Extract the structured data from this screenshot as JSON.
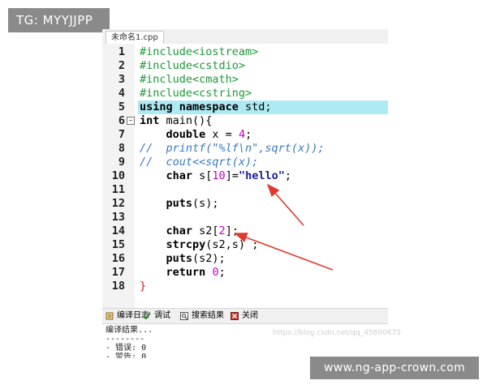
{
  "watermarks": {
    "top_left": "TG: MYYJJPP",
    "bottom_right": "www.ng-app-crown.com"
  },
  "tabbar": {
    "file_tab": "未命名1.cpp"
  },
  "code": {
    "lines": [
      {
        "num": "1",
        "html": "<span class=\"pre\">#include&lt;iostream&gt;</span>"
      },
      {
        "num": "2",
        "html": "<span class=\"pre\">#include&lt;cstdio&gt;</span>"
      },
      {
        "num": "3",
        "html": "<span class=\"pre\">#include&lt;cmath&gt;</span>"
      },
      {
        "num": "4",
        "html": "<span class=\"pre\">#include&lt;cstring&gt;</span>"
      },
      {
        "num": "5",
        "html": "<span class=\"kw\">using namespace</span> std;",
        "highlight": true
      },
      {
        "num": "6",
        "html": "<span class=\"kw\">int</span> main(){",
        "fold": true
      },
      {
        "num": "7",
        "html": "    <span class=\"kw\">double</span> x = <span class=\"num\">4</span>;"
      },
      {
        "num": "8",
        "html": "<span class=\"cmt\">//  printf(\"%lf\\n\",sqrt(x));</span>"
      },
      {
        "num": "9",
        "html": "<span class=\"cmt\">//  cout&lt;&lt;sqrt(x);</span>"
      },
      {
        "num": "10",
        "html": "    <span class=\"kw\">char</span> s[<span class=\"num\">10</span>]=<span class=\"str\">\"hello\"</span>;"
      },
      {
        "num": "11",
        "html": ""
      },
      {
        "num": "12",
        "html": "    <span class=\"kw\">puts</span>(s);"
      },
      {
        "num": "13",
        "html": ""
      },
      {
        "num": "14",
        "html": "    <span class=\"kw\">char</span> s2[<span class=\"num\">2</span>];"
      },
      {
        "num": "15",
        "html": "    <span class=\"kw\">strcpy</span>(s2,s) ;"
      },
      {
        "num": "16",
        "html": "    <span class=\"kw\">puts</span>(s2);"
      },
      {
        "num": "17",
        "html": "    <span class=\"kw\">return</span> <span class=\"num\">0</span>;"
      },
      {
        "num": "18",
        "html": "<span class=\"brace\">}</span>",
        "fold_end": true
      }
    ]
  },
  "bottom_tabs": {
    "compile_log": "编译日志",
    "debug": "调试",
    "search_results": "搜索结果",
    "close": "关闭"
  },
  "output": {
    "line1": "编译结果...",
    "line2": "--------",
    "line3": "- 错误: 0",
    "line4": "- 警告: 0",
    "faint_url": "https://blog.csdn.net/qq_45600675"
  },
  "colors": {
    "highlight": "#aeeaf3",
    "arrow": "#e03a2e"
  }
}
